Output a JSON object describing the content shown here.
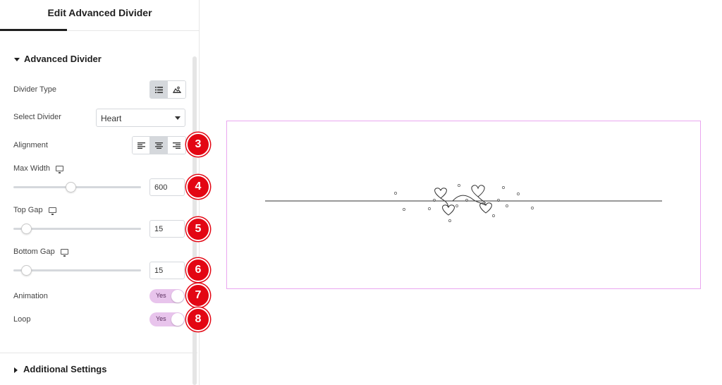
{
  "panel": {
    "title": "Edit Advanced Divider",
    "section_title": "Advanced Divider",
    "additional_settings": "Additional Settings"
  },
  "controls": {
    "divider_type": {
      "label": "Divider Type",
      "options": [
        "list-icon",
        "image-icon"
      ],
      "active": "list-icon"
    },
    "select_divider": {
      "label": "Select Divider",
      "value": "Heart"
    },
    "alignment": {
      "label": "Alignment",
      "options": [
        "align-left-icon",
        "align-center-icon",
        "align-right-icon"
      ],
      "active": "align-center-icon"
    },
    "max_width": {
      "label": "Max Width",
      "value": "600",
      "slider_fraction": 0.45
    },
    "top_gap": {
      "label": "Top Gap",
      "value": "15",
      "slider_fraction": 0.1
    },
    "bottom_gap": {
      "label": "Bottom Gap",
      "value": "15",
      "slider_fraction": 0.1
    },
    "animation": {
      "label": "Animation",
      "value": "Yes"
    },
    "loop": {
      "label": "Loop",
      "value": "Yes"
    }
  },
  "badges": [
    "3",
    "4",
    "5",
    "6",
    "7",
    "8"
  ],
  "colors": {
    "badge_red": "#e30613",
    "toggle_pink": "#e8c4ec",
    "frame_pink": "#e9a6f0",
    "active_segment": "#d5d8dc"
  },
  "preview": {
    "divider_style": "heart",
    "icon": "heart-divider-icon"
  }
}
